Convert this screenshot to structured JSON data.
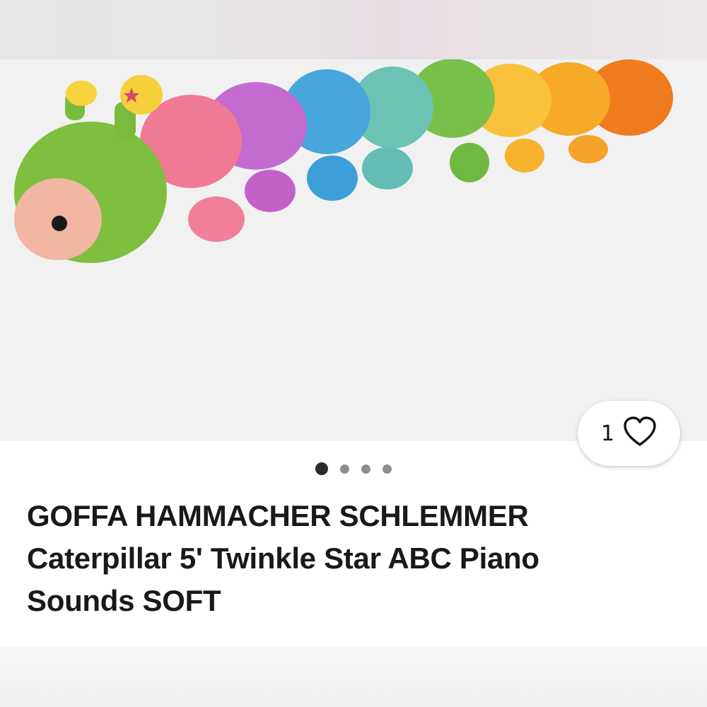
{
  "listing": {
    "title_line1": "GOFFA HAMMACHER SCHLEMMER",
    "title_line2": "Caterpillar 5' Twinkle Star ABC Piano",
    "title_line3": "Sounds SOFT",
    "like_count": "1",
    "like_icon": "heart-outline-icon"
  },
  "carousel": {
    "image_count": 4,
    "active_index": 0,
    "image_subject": "rainbow-caterpillar-plush"
  },
  "colors": {
    "background": "#ffffff",
    "photo_background": "#f1f1f2",
    "title_text": "#191919",
    "dot_active": "#2b2b2b",
    "dot_inactive": "#8e8e8e"
  }
}
